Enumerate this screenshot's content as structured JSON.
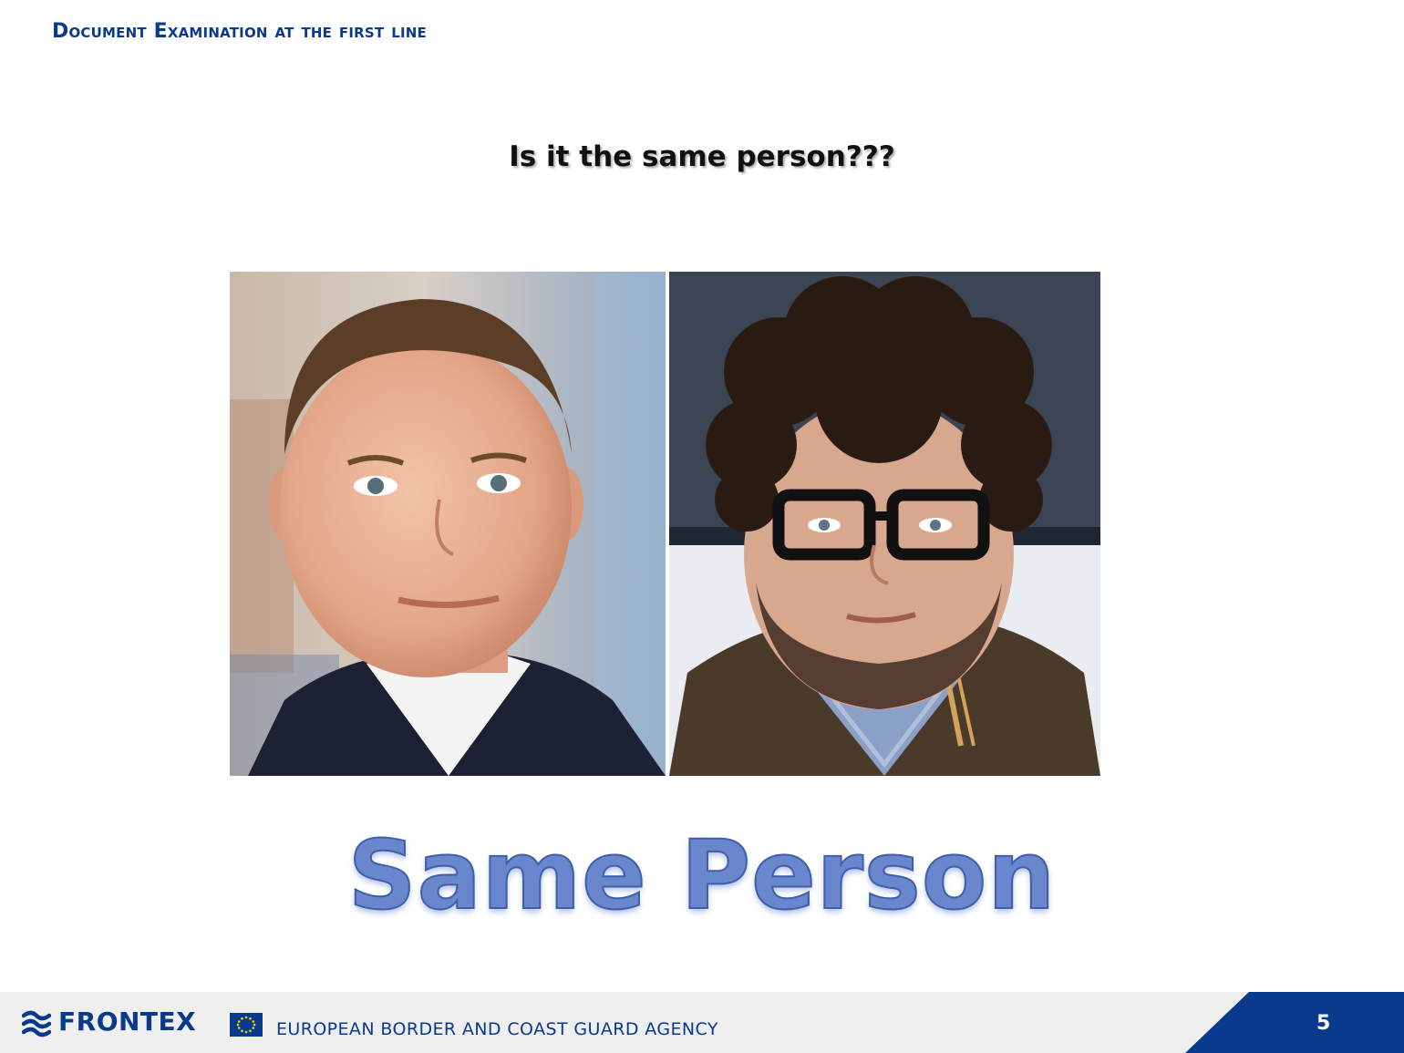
{
  "header": {
    "title": "Document Examination at the first line"
  },
  "slide": {
    "question": "Is it the same person???",
    "answer": "Same Person"
  },
  "photos": [
    {
      "icon": "portrait-photo-short-hair-suit"
    },
    {
      "icon": "portrait-photo-curly-hair-glasses"
    }
  ],
  "footer": {
    "brand": "FRONTEX",
    "agency": "EUROPEAN BORDER AND COAST GUARD AGENCY",
    "page_number": "5",
    "logo_icon": "frontex-waves-icon",
    "flag_icon": "eu-flag-icon"
  },
  "colors": {
    "brand_blue": "#0a3a8c",
    "answer_blue": "#6a86cc",
    "footer_gray": "#efefef"
  }
}
